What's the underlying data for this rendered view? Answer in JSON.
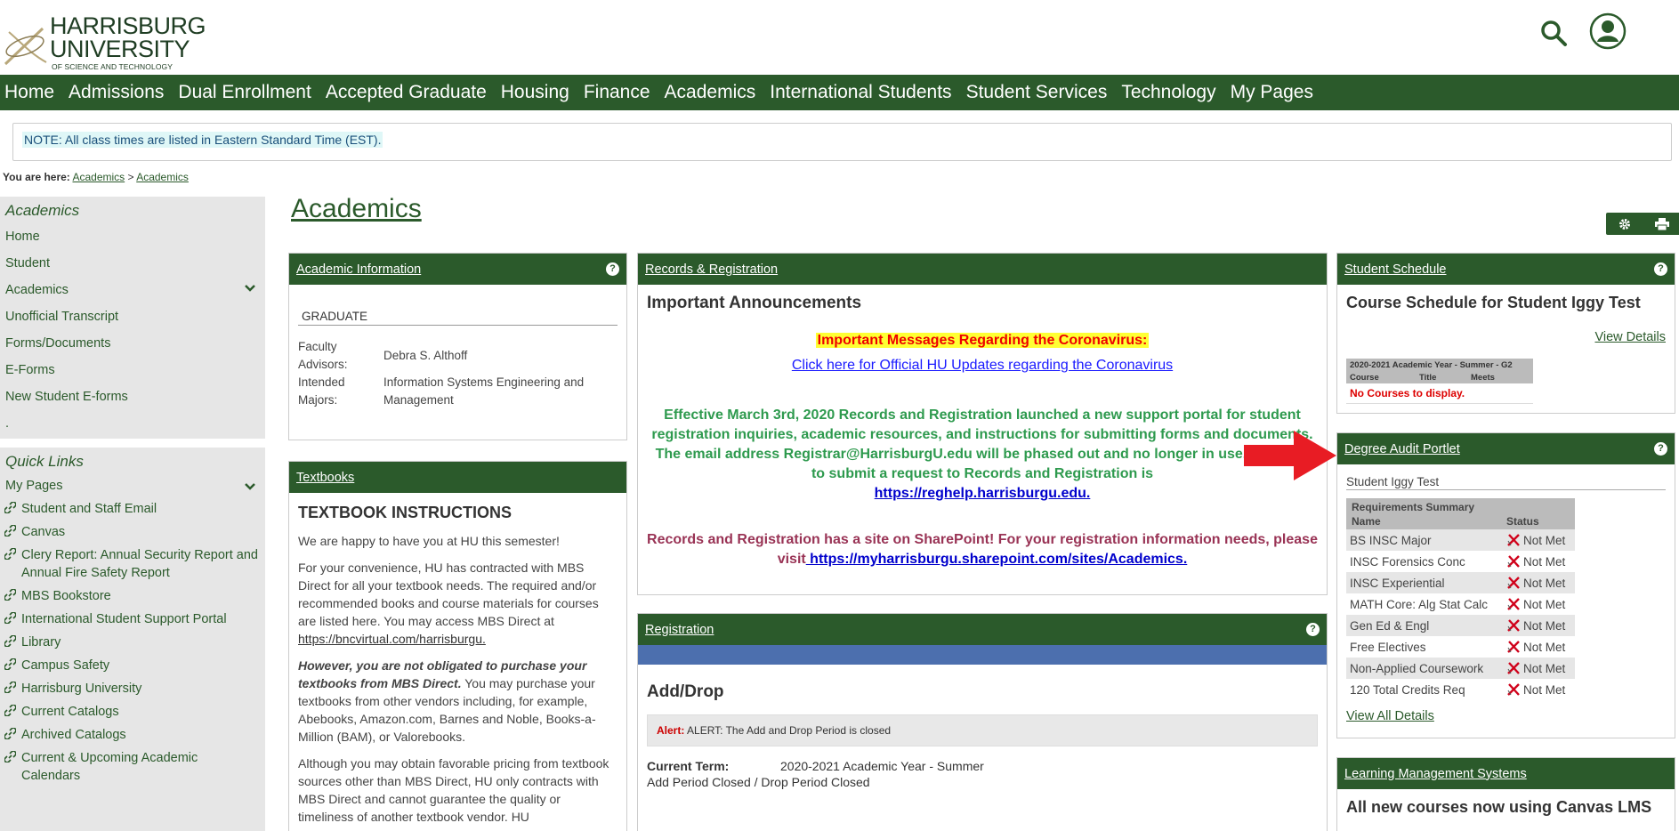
{
  "logo": {
    "line1": "HARRISBURG",
    "line2": "UNIVERSITY",
    "line3": "OF SCIENCE AND TECHNOLOGY"
  },
  "nav": [
    "Home",
    "Admissions",
    "Dual Enrollment",
    "Accepted Graduate",
    "Housing",
    "Finance",
    "Academics",
    "International Students",
    "Student Services",
    "Technology",
    "My Pages"
  ],
  "note": "NOTE: All class times are listed in Eastern Standard Time (EST).",
  "breadcrumb": {
    "label": "You are here:",
    "crumb1": "Academics",
    "sep": ">",
    "crumb2": "Academics"
  },
  "sidebar": {
    "title": "Academics",
    "items": [
      "Home",
      "Student",
      "Academics",
      "Unofficial Transcript",
      "Forms/Documents",
      "E-Forms",
      "New Student E-forms",
      "."
    ]
  },
  "quick_links": {
    "title": "Quick Links",
    "my_pages": "My Pages",
    "items": [
      "Student and Staff Email",
      "Canvas",
      "Clery Report: Annual Security Report and Annual Fire Safety Report",
      "MBS Bookstore",
      "International Student Support Portal",
      "Library",
      "Campus Safety",
      "Harrisburg University",
      "Current Catalogs",
      "Archived Catalogs",
      "Current & Upcoming Academic Calendars"
    ]
  },
  "page_title": "Academics",
  "academic_info": {
    "title": "Academic Information",
    "level": "GRADUATE",
    "advisors_label": "Faculty Advisors:",
    "advisors_value": "Debra S. Althoff",
    "majors_label": "Intended Majors:",
    "majors_value": "Information Systems Engineering and Management"
  },
  "textbooks": {
    "title": "Textbooks",
    "heading": "TEXTBOOK INSTRUCTIONS",
    "p1": "We are happy to have you at HU this semester!",
    "p2": "For your convenience, HU has contracted with MBS Direct for all your textbook needs.  The required and/or recommended books and course materials for courses are listed here. You may access MBS Direct at ",
    "p2_link": "https://bncvirtual.com/harrisburgu.",
    "p3_bold": "However, you are not obligated to purchase your textbooks from MBS Direct.",
    "p3_rest": " You may purchase your textbooks from other vendors including, for example, Abebooks, Amazon.com, Barnes and Noble, Books-a-Million (BAM), or Valorebooks.",
    "p4": "Although you may obtain favorable pricing from textbook sources other than MBS Direct, HU only contracts with MBS Direct and cannot guarantee the quality or timeliness of another textbook vendor. HU"
  },
  "records": {
    "title": "Records & Registration",
    "heading": "Important Announcements",
    "corona_title": "Important Messages Regarding the Coronavirus:",
    "corona_link": "Click here for Official HU Updates regarding the Coronavirus",
    "green_text": "Effective March 3rd, 2020 Records and Registration launched a new support portal for student registration inquiries, academic resources, and instructions for submitting forms and documents.  The email address Registrar@HarrisburgU.edu will be phased out and no longer in use. The URL to submit a request to Records and Registration is",
    "green_link": "https://reghelp.harrisburgu.edu.",
    "maroon_text": "Records and Registration has a site on SharePoint! For your registration information needs, please visit",
    "maroon_link": " https://myharrisburgu.sharepoint.com/sites/Academics."
  },
  "registration": {
    "title": "Registration",
    "heading": "Add/Drop",
    "alert_label": "Alert:",
    "alert_text": "ALERT: The Add and Drop Period is closed",
    "term_label": "Current Term:",
    "term_value": "2020-2021 Academic Year - Summer",
    "period_status": "Add Period Closed / Drop Period Closed"
  },
  "schedule": {
    "title": "Student Schedule",
    "heading": "Course Schedule for Student Iggy Test",
    "view_details": "View Details",
    "table_header": "2020-2021 Academic Year - Summer - G2",
    "cols": [
      "Course",
      "Title",
      "Meets"
    ],
    "empty": "No Courses to display."
  },
  "degree_audit": {
    "title": "Degree Audit Portlet",
    "student": "Student Iggy Test",
    "summary_label": "Requirements Summary",
    "col_name": "Name",
    "col_status": "Status",
    "rows": [
      {
        "name": "BS INSC Major",
        "status": "Not Met"
      },
      {
        "name": "INSC Forensics Conc",
        "status": "Not Met"
      },
      {
        "name": "INSC Experiential",
        "status": "Not Met"
      },
      {
        "name": "MATH Core: Alg Stat Calc",
        "status": "Not Met"
      },
      {
        "name": "Gen Ed & Engl",
        "status": "Not Met"
      },
      {
        "name": "Free Electives",
        "status": "Not Met"
      },
      {
        "name": "Non-Applied Coursework",
        "status": "Not Met"
      },
      {
        "name": "120 Total Credits Req",
        "status": "Not Met"
      }
    ],
    "view_all": "View All Details"
  },
  "lms": {
    "title": "Learning Management Systems",
    "heading": "All new courses now using Canvas LMS"
  },
  "colors": {
    "brand_green": "#2b5a2b",
    "accent_blue": "#4c6fae",
    "alert_red": "#e81c24"
  }
}
